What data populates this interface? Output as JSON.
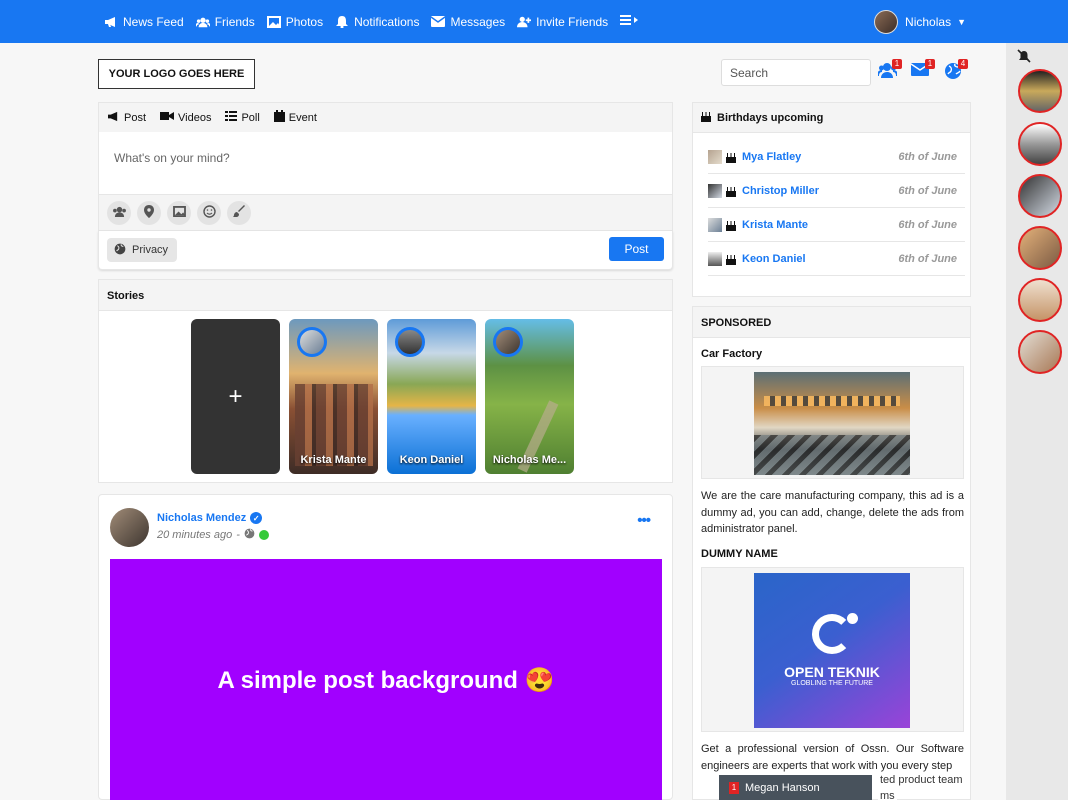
{
  "nav": {
    "items": [
      {
        "label": "News Feed",
        "icon": "megaphone-icon"
      },
      {
        "label": "Friends",
        "icon": "users-icon"
      },
      {
        "label": "Photos",
        "icon": "image-icon"
      },
      {
        "label": "Notifications",
        "icon": "bell-icon"
      },
      {
        "label": "Messages",
        "icon": "envelope-icon"
      },
      {
        "label": "Invite Friends",
        "icon": "user-plus-icon"
      }
    ],
    "user_name": "Nicholas"
  },
  "header": {
    "logo_text": "YOUR LOGO GOES HERE",
    "search_placeholder": "Search",
    "friends_badge": "1",
    "messages_badge": "1",
    "notifications_badge": "4"
  },
  "composer": {
    "tabs": [
      "Post",
      "Videos",
      "Poll",
      "Event"
    ],
    "placeholder": "What's on your mind?",
    "privacy_label": "Privacy",
    "post_label": "Post"
  },
  "stories": {
    "title": "Stories",
    "add_label": "+",
    "items": [
      "Krista Mante",
      "Keon Daniel",
      "Nicholas Me..."
    ]
  },
  "post": {
    "author": "Nicholas Mendez",
    "time": "20 minutes ago",
    "separator": "-",
    "text": "A simple post background 😍",
    "more": "•••"
  },
  "birthdays": {
    "title": "Birthdays upcoming",
    "items": [
      {
        "name": "Mya Flatley",
        "date": "6th of June"
      },
      {
        "name": "Christop Miller",
        "date": "6th of June"
      },
      {
        "name": "Krista Mante",
        "date": "6th of June"
      },
      {
        "name": "Keon Daniel",
        "date": "6th of June"
      }
    ]
  },
  "sponsored": {
    "title": "SPONSORED",
    "ads": [
      {
        "title": "Car Factory",
        "text": "We are the care manufacturing company, this ad is a dummy ad, you can add, change, delete the ads from administrator panel."
      },
      {
        "title": "DUMMY NAME",
        "text": "Get a professional version of Ossn. Our Software engineers are experts that work with you every step",
        "brand": "OPEN TEKNIK",
        "tagline": "GLOBLING THE FUTURE"
      }
    ],
    "partial_text_1": "ted product team",
    "partial_text_2": "ms"
  },
  "chat": {
    "name": "Megan Hanson",
    "badge": "1"
  }
}
